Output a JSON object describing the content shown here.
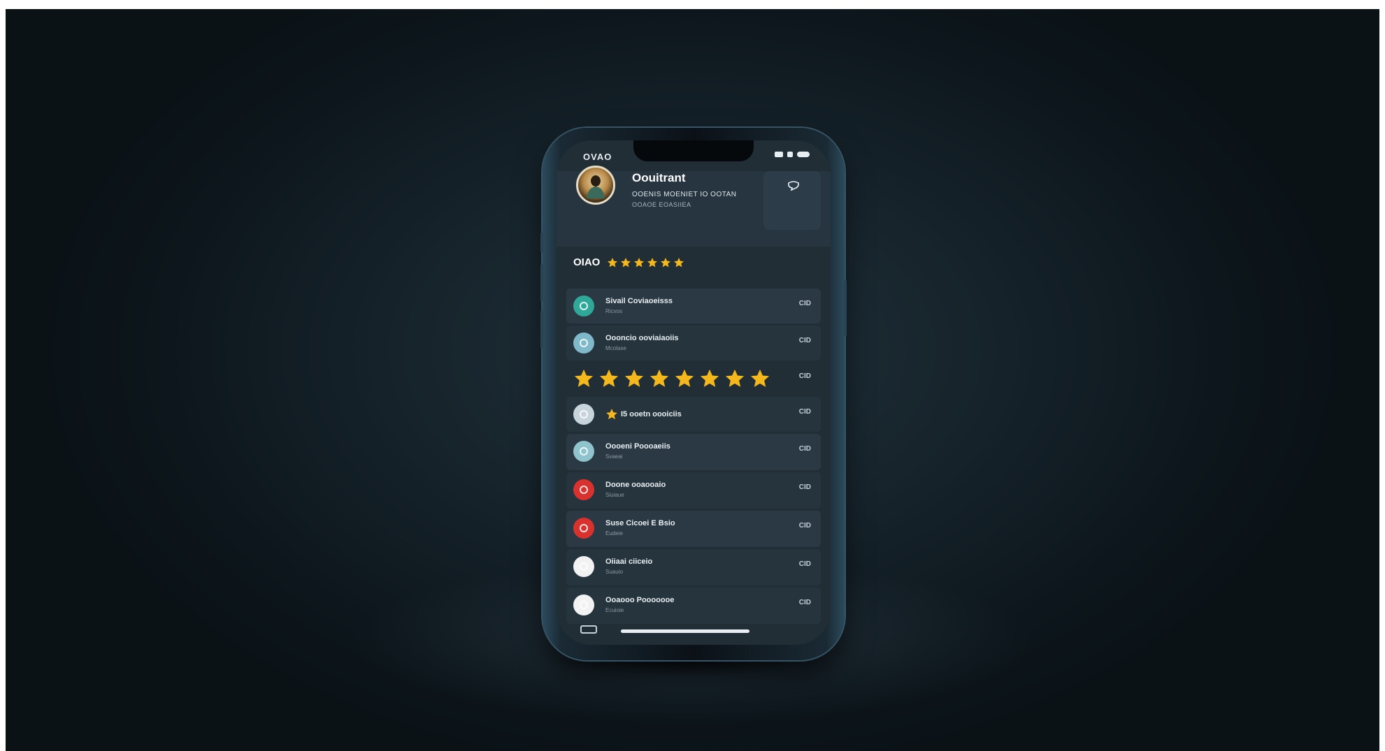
{
  "status_bar": {
    "time": "OVAO"
  },
  "profile": {
    "name": "Oouitrant",
    "line1": "OOENIS MOENIET IO OOTAN",
    "line2": "OOAOE EOASIIEA"
  },
  "rating": {
    "label": "OIAO",
    "stars_filled": 6,
    "stars_total": 6
  },
  "featured_rating": {
    "stars_filled": 8,
    "stars_total": 8,
    "action": "CID"
  },
  "items": [
    {
      "title": "Sivail Coviaoeisss",
      "subtitle": "Ricvos",
      "action": "CID",
      "icon": "eye-icon",
      "icon_color": "#2fa89a"
    },
    {
      "title": "Oooncio ooviaiaoiis",
      "subtitle": "Mcolase",
      "action": "CID",
      "icon": "clock-icon",
      "icon_color": "#7fb8c8"
    },
    {
      "title": "I5 ooetn oooiciis",
      "subtitle": "",
      "action": "CID",
      "icon": "globe-icon",
      "icon_color": "#c8d4dc",
      "has_star": true
    },
    {
      "title": "Oooeni Poooaeiis",
      "subtitle": "Svaeai",
      "action": "CID",
      "icon": "target-icon",
      "icon_color": "#8fc4cc"
    },
    {
      "title": "Doone ooaooaio",
      "subtitle": "Siuiaue",
      "action": "CID",
      "icon": "alert-icon",
      "icon_color": "#d9322e"
    },
    {
      "title": "Suse Cicoei E Bsio",
      "subtitle": "Eudeie",
      "action": "CID",
      "icon": "record-icon",
      "icon_color": "#d9322e"
    },
    {
      "title": "Oiiaai ciiceio",
      "subtitle": "Suauio",
      "action": "CID",
      "icon": "heart-icon",
      "icon_color": "#f2f2f2"
    },
    {
      "title": "Ooaooo Pooooooe",
      "subtitle": "Ecuioie",
      "action": "CID",
      "icon": "eye-icon",
      "icon_color": "#f2f2f2"
    }
  ],
  "colors": {
    "star": "#f4b81c",
    "screen_bg": "#222e36",
    "accent_red": "#d9322e"
  }
}
